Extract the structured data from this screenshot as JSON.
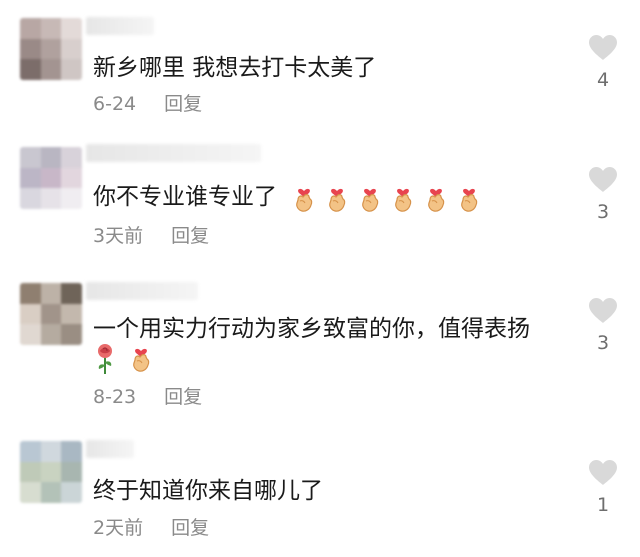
{
  "comments": [
    {
      "text": "新乡哪里 我想去打卡太美了",
      "date": "6-24",
      "reply_label": "回复",
      "likes": "4",
      "avatar_colors": [
        "#b8a7a4",
        "#c7b9b6",
        "#e3dad8",
        "#9a8a87",
        "#b0a19e",
        "#d8cfcd",
        "#7c6d6a",
        "#a39491",
        "#cfc6c4"
      ]
    },
    {
      "text": "你不专业谁专业了",
      "emoji_count": 6,
      "date": "3天前",
      "reply_label": "回复",
      "likes": "3",
      "avatar_colors": [
        "#c9c7d0",
        "#b9b6c2",
        "#d8d2da",
        "#bcb6c6",
        "#c8b7c8",
        "#e2d6de",
        "#d9d7df",
        "#e6e2e8",
        "#f0edf1"
      ]
    },
    {
      "text": "一个用实力行动为家乡致富的你，值得表扬",
      "emoji_line": [
        "rose",
        "hand"
      ],
      "date": "8-23",
      "reply_label": "回复",
      "likes": "3",
      "avatar_colors": [
        "#8f7f70",
        "#bdb2a7",
        "#6f6459",
        "#d9cec4",
        "#a1948a",
        "#c3b8ad",
        "#e0d8d1",
        "#b5aba0",
        "#9a8e83"
      ]
    },
    {
      "text": "终于知道你来自哪儿了",
      "date": "2天前",
      "reply_label": "回复",
      "likes": "1",
      "avatar_colors": [
        "#b9c7d3",
        "#d0d8de",
        "#a9b8c3",
        "#bfcab8",
        "#c9d3c1",
        "#a8b6b0",
        "#d7ddd0",
        "#b3c2b8",
        "#cbd5d7"
      ]
    }
  ]
}
